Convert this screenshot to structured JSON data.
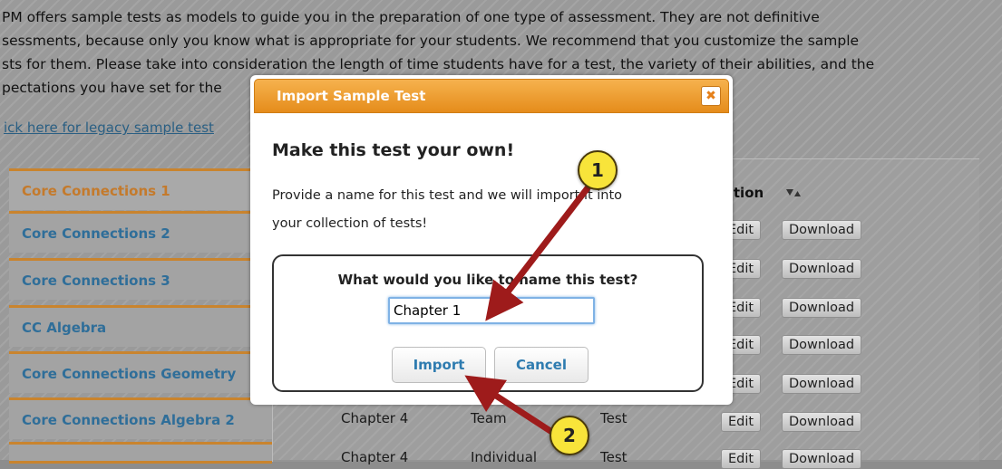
{
  "intro_lines": [
    "PM offers sample tests as models to guide you in the preparation of one type of assessment. They are not definitive",
    "sessments, because only you know what is appropriate for your students. We recommend that you customize the sample",
    "sts for them. Please take into consideration the length of time students have for a test, the variety of their abilities, and the",
    "pectations you have set for the"
  ],
  "legacy_link": "ick here for legacy sample test",
  "sidebar": {
    "items": [
      {
        "label": "Core Connections 1"
      },
      {
        "label": "Core Connections 2"
      },
      {
        "label": "Core Connections 3"
      },
      {
        "label": "CC Algebra"
      },
      {
        "label": "Core Connections Geometry"
      },
      {
        "label": "Core Connections Algebra 2"
      },
      {
        "label": ""
      }
    ]
  },
  "table": {
    "action_header": "ction",
    "edit_label": "Edit",
    "download_label": "Download",
    "visible_rows": [
      {
        "chapter": "Chapter 4",
        "type": "Team",
        "kind": "Test"
      },
      {
        "chapter": "Chapter 4",
        "type": "Individual",
        "kind": "Test"
      }
    ]
  },
  "modal": {
    "title": "Import Sample Test",
    "close_glyph": "✖",
    "heading": "Make this test your own!",
    "description_line1": "Provide a name for this test and we will import it into",
    "description_line2": "your collection of tests!",
    "name_prompt": "What would you like to name this test?",
    "name_value": "Chapter 1",
    "import_label": "Import",
    "cancel_label": "Cancel"
  },
  "callouts": [
    {
      "number": "1"
    },
    {
      "number": "2"
    }
  ],
  "colors": {
    "accent_orange": "#e58c1b",
    "link_blue": "#2f7cb0",
    "callout_yellow": "#f8e43a",
    "arrow_red": "#9e1b1b"
  }
}
